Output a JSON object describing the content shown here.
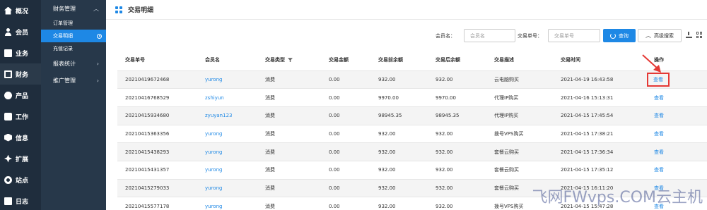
{
  "primary_nav": [
    {
      "label": "概况",
      "icon": "home-icon"
    },
    {
      "label": "会员",
      "icon": "user-icon"
    },
    {
      "label": "业务",
      "icon": "business-icon"
    },
    {
      "label": "财务",
      "icon": "finance-icon",
      "active": true
    },
    {
      "label": "产品",
      "icon": "product-icon"
    },
    {
      "label": "工作",
      "icon": "work-icon"
    },
    {
      "label": "信息",
      "icon": "info-icon"
    },
    {
      "label": "扩展",
      "icon": "extension-icon"
    },
    {
      "label": "站点",
      "icon": "site-icon"
    },
    {
      "label": "日志",
      "icon": "log-icon"
    }
  ],
  "secondary_nav": {
    "group_title": "财务管理",
    "items": [
      {
        "label": "订单管理"
      },
      {
        "label": "交易明细",
        "active": true
      },
      {
        "label": "充值记录"
      }
    ],
    "groups": [
      {
        "label": "报表统计"
      },
      {
        "label": "推广管理"
      }
    ]
  },
  "header": {
    "title": "交易明细"
  },
  "toolbar": {
    "member_label": "会员名：",
    "member_placeholder": "会员名",
    "trade_label": "交易单号：",
    "trade_placeholder": "交易单号",
    "query_label": "查询",
    "advanced_label": "高级搜索"
  },
  "table": {
    "columns": [
      "交易单号",
      "会员名",
      "交易类型",
      "交易金额",
      "交易前余额",
      "交易后余额",
      "交易描述",
      "交易时间",
      "操作"
    ],
    "rows": [
      {
        "id": "20210419672468",
        "member": "yurong",
        "type": "消费",
        "amount": "0.00",
        "before": "932.00",
        "after": "932.00",
        "desc": "云电脑购买",
        "time": "2021-04-19 16:43:58",
        "action": "查看"
      },
      {
        "id": "20210416768529",
        "member": "zshiyun",
        "type": "消费",
        "amount": "0.00",
        "before": "9970.00",
        "after": "9970.00",
        "desc": "代理IP购买",
        "time": "2021-04-16 15:13:31",
        "action": "查看"
      },
      {
        "id": "20210415934680",
        "member": "zyuyan123",
        "type": "消费",
        "amount": "0.00",
        "before": "98945.35",
        "after": "98945.35",
        "desc": "代理IP购买",
        "time": "2021-04-15 17:45:54",
        "action": "查看"
      },
      {
        "id": "20210415363356",
        "member": "yurong",
        "type": "消费",
        "amount": "0.00",
        "before": "932.00",
        "after": "932.00",
        "desc": "拨号VPS购买",
        "time": "2021-04-15 17:38:21",
        "action": "查看"
      },
      {
        "id": "20210415438293",
        "member": "yurong",
        "type": "消费",
        "amount": "0.00",
        "before": "932.00",
        "after": "932.00",
        "desc": "套餐云购买",
        "time": "2021-04-15 17:36:34",
        "action": "查看"
      },
      {
        "id": "20210415431357",
        "member": "yurong",
        "type": "消费",
        "amount": "0.00",
        "before": "932.00",
        "after": "932.00",
        "desc": "套餐云购买",
        "time": "2021-04-15 17:35:12",
        "action": "查看"
      },
      {
        "id": "20210415279033",
        "member": "yurong",
        "type": "消费",
        "amount": "0.00",
        "before": "932.00",
        "after": "932.00",
        "desc": "套餐云购买",
        "time": "2021-04-15 16:11:20",
        "action": "查看"
      },
      {
        "id": "20210415577178",
        "member": "yurong",
        "type": "消费",
        "amount": "0.00",
        "before": "932.00",
        "after": "932.00",
        "desc": "拨号VPS购买",
        "time": "2021-04-15 15:47:28",
        "action": "查看"
      }
    ]
  },
  "watermark": "飞网FWvps.COM云主机",
  "colors": {
    "accent": "#1e88e5",
    "sidebar": "#1f2d3d",
    "highlight": "#e53935"
  }
}
